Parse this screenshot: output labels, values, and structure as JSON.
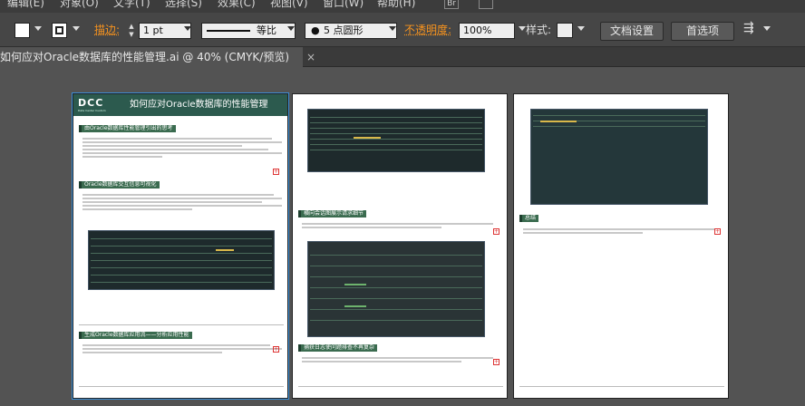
{
  "menubar": {
    "items": [
      "编辑(E)",
      "对象(O)",
      "文字(T)",
      "选择(S)",
      "效果(C)",
      "视图(V)",
      "窗口(W)",
      "帮助(H)"
    ],
    "br_badge": "Br"
  },
  "control_bar": {
    "fill_color": "#ffffff",
    "stroke_label": "描边:",
    "stroke_weight": "1 pt",
    "stroke_profile": "等比",
    "brush": "5 点圆形",
    "opacity_label": "不透明度:",
    "opacity_value": "100%",
    "style_label": "样式:",
    "doc_settings_button": "文档设置",
    "preferences_button": "首选项"
  },
  "tab": {
    "title": "如何应对Oracle数据库的性能管理.ai @ 40% (CMYK/预览)",
    "close": "×"
  },
  "page1": {
    "logo": "DCC",
    "logo_sub": "Data Center Custom",
    "title": "如何应对Oracle数据库的性能管理",
    "section1": "由Oracle数据库性能管理引出的思考",
    "section2": "Oracle数据库交互信息可视化",
    "section3": "生成Oracle数据库应用流——分析应用性能",
    "plus": "+"
  },
  "page2": {
    "section1": "横向会话图展示请求细节",
    "section2": "捕获日志使问题排查不再复杂",
    "plus": "+"
  },
  "page3": {
    "section1": "总结",
    "plus": "+"
  }
}
